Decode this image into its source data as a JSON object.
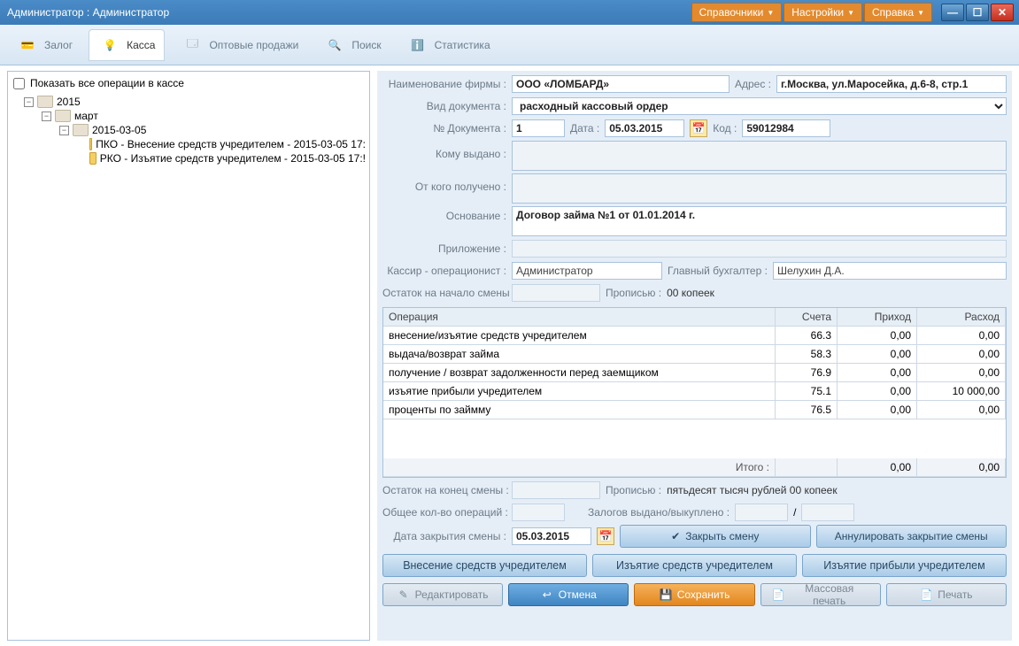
{
  "title": "Администратор : Администратор",
  "top_menu": {
    "refs": "Справочники",
    "settings": "Настройки",
    "help": "Справка"
  },
  "tabs": {
    "zalog": "Залог",
    "kassa": "Касса",
    "opt": "Оптовые продажи",
    "search": "Поиск",
    "stat": "Статистика"
  },
  "tree": {
    "show_all": "Показать все операции в кассе",
    "y": "2015",
    "m": "март",
    "d": "2015-03-05",
    "op1": "ПКО - Внесение средств учредителем - 2015-03-05 17:",
    "op2": "РКО - Изъятие средств учредителем - 2015-03-05 17:!"
  },
  "labels": {
    "firm": "Наименование фирмы :",
    "addr": "Адрес :",
    "doctype": "Вид документа :",
    "docno": "№ Документа :",
    "date": "Дата :",
    "code": "Код :",
    "issued_to": "Кому выдано :",
    "received_from": "От кого получено :",
    "basis": "Основание :",
    "app": "Приложение :",
    "cashier": "Кассир - операционист :",
    "chief": "Главный бухгалтер :",
    "bal_start": "Остаток на начало смены :",
    "in_words": "Прописью :",
    "bal_end": "Остаток на конец смены :",
    "in_words2": "Прописью :",
    "total_ops": "Общее кол-во операций :",
    "zalog_io": "Залогов выдано/выкуплено :",
    "close_date": "Дата закрытия смены :"
  },
  "values": {
    "firm": "ООО «ЛОМБАРД»",
    "addr": "г.Москва, ул.Маросейка, д.6-8, стр.1",
    "doctype": "расходный кассовый ордер",
    "docno": "1",
    "date": "05.03.2015",
    "code": "59012984",
    "basis": "Договор займа №1 от 01.01.2014 г.",
    "cashier": "Администратор",
    "chief": "Шелухин Д.А.",
    "bal_start": "",
    "bal_start_words": "00 копеек",
    "bal_end_words": "пятьдесят тысяч рублей 00 копеек",
    "close_date": "05.03.2015"
  },
  "table": {
    "h_op": "Операция",
    "h_sc": "Счета",
    "h_pr": "Приход",
    "h_rs": "Расход",
    "rows": [
      {
        "op": "внесение/изъятие средств учредителем",
        "sc": "66.3",
        "pr": "0,00",
        "rs": "0,00"
      },
      {
        "op": "выдача/возврат займа",
        "sc": "58.3",
        "pr": "0,00",
        "rs": "0,00"
      },
      {
        "op": "получение / возврат задолженности перед заемщиком",
        "sc": "76.9",
        "pr": "0,00",
        "rs": "0,00"
      },
      {
        "op": "изъятие прибыли учредителем",
        "sc": "75.1",
        "pr": "0,00",
        "rs": "10 000,00"
      },
      {
        "op": "проценты по займму",
        "sc": "76.5",
        "pr": "0,00",
        "rs": "0,00"
      }
    ],
    "total": "Итого :",
    "t_pr": "0,00",
    "t_rs": "0,00"
  },
  "buttons": {
    "close_shift": "Закрыть смену",
    "annul": "Аннулировать закрытие смены",
    "b1": "Внесение средств учредителем",
    "b2": "Изъятие средств учредителем",
    "b3": "Изъятие прибыли учредителем",
    "edit": "Редактировать",
    "cancel": "Отмена",
    "save": "Сохранить",
    "mass": "Массовая печать",
    "print": "Печать"
  }
}
